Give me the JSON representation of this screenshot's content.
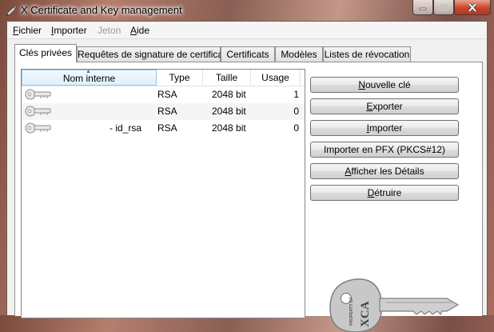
{
  "window": {
    "title": "X Certificate and Key management",
    "icon": "pen-icon",
    "controls": [
      "minimize-icon",
      "maximize-icon",
      "close-icon"
    ]
  },
  "menu": [
    {
      "first": "F",
      "rest": "ichier",
      "disabled": false
    },
    {
      "first": "I",
      "rest": "mporter",
      "disabled": false
    },
    {
      "first": "J",
      "rest": "eton",
      "disabled": true
    },
    {
      "first": "A",
      "rest": "ide",
      "disabled": false
    }
  ],
  "tabs": [
    {
      "label": "Clés privées",
      "active": true
    },
    {
      "label": "Requêtes de signature de certificat",
      "active": false
    },
    {
      "label": "Certificats",
      "active": false
    },
    {
      "label": "Modèles",
      "active": false
    },
    {
      "label": "Listes de révocation",
      "active": false
    }
  ],
  "keys_table": {
    "columns": [
      "Nom interne",
      "Type",
      "Taille",
      "Usage"
    ],
    "sorted_column": "Nom interne",
    "rows": [
      {
        "name": "",
        "type": "RSA",
        "size": "2048 bit",
        "usage": "1"
      },
      {
        "name": "",
        "type": "RSA",
        "size": "2048 bit",
        "usage": "0"
      },
      {
        "name": "- id_rsa",
        "type": "RSA",
        "size": "2048 bit",
        "usage": "0"
      }
    ]
  },
  "buttons": [
    {
      "pre": "",
      "ul": "N",
      "post": "ouvelle clé"
    },
    {
      "pre": "",
      "ul": "E",
      "post": "xporter"
    },
    {
      "pre": "",
      "ul": "I",
      "post": "mporter"
    },
    {
      "pre": "Importer en PFX (PKCS#12)",
      "ul": "",
      "post": ""
    },
    {
      "pre": "",
      "ul": "A",
      "post": "fficher les Détails"
    },
    {
      "pre": "",
      "ul": "D",
      "post": "étruire"
    }
  ],
  "logo": {
    "line1": "PROPERTY OF",
    "line2": "XCA"
  },
  "colors": {
    "window_frame": "#7b4a3c",
    "close_button": "#c8452c",
    "sorted_header": "#dff0fb",
    "key_gray": "#8c8c8c"
  }
}
